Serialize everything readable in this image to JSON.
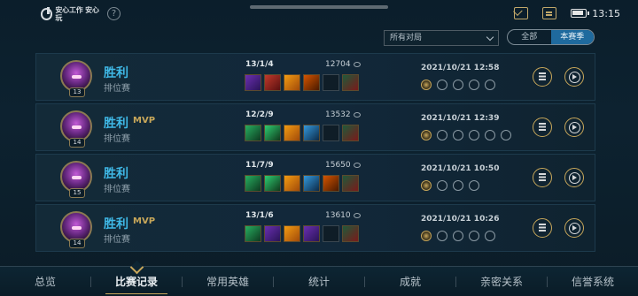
{
  "status_bar": {
    "app_logo_text": "安心工作 安心玩",
    "help_symbol": "?",
    "time": "13:15"
  },
  "filters": {
    "queue_filter_value": "所有对局",
    "season_options": [
      {
        "label": "全部",
        "active": false
      },
      {
        "label": "本赛季",
        "active": true
      }
    ]
  },
  "matches": [
    {
      "level": "13",
      "result": "胜利",
      "mvp": "",
      "mode": "排位赛",
      "kda": "13/1/4",
      "gold": "12704",
      "datetime": "2021/10/21 12:58"
    },
    {
      "level": "14",
      "result": "胜利",
      "mvp": "MVP",
      "mode": "排位赛",
      "kda": "12/2/9",
      "gold": "13532",
      "datetime": "2021/10/21 12:39"
    },
    {
      "level": "15",
      "result": "胜利",
      "mvp": "",
      "mode": "排位赛",
      "kda": "11/7/9",
      "gold": "15650",
      "datetime": "2021/10/21 10:50"
    },
    {
      "level": "14",
      "result": "胜利",
      "mvp": "MVP",
      "mode": "排位赛",
      "kda": "13/1/6",
      "gold": "13610",
      "datetime": "2021/10/21 10:26"
    }
  ],
  "bottom_nav": [
    {
      "label": "总览",
      "active": false
    },
    {
      "label": "比赛记录",
      "active": true
    },
    {
      "label": "常用英雄",
      "active": false
    },
    {
      "label": "统计",
      "active": false
    },
    {
      "label": "成就",
      "active": false
    },
    {
      "label": "亲密关系",
      "active": false
    },
    {
      "label": "信誉系统",
      "active": false
    }
  ],
  "colors": {
    "accent_blue": "#3fb8e6",
    "gold": "#c8a75a",
    "active_segment": "#1f6a9e"
  }
}
